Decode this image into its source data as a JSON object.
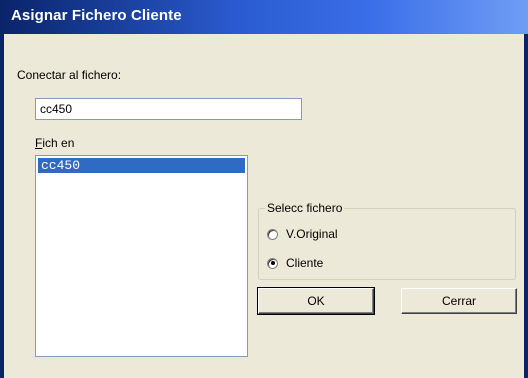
{
  "window": {
    "title": "Asignar Fichero Cliente"
  },
  "connect": {
    "label": "Conectar al fichero:",
    "value": "cc450"
  },
  "list": {
    "label_prefix": "F",
    "label_rest": "ich en",
    "items": [
      "cc450"
    ]
  },
  "select_group": {
    "legend": "Selecc fichero",
    "options": [
      {
        "label": "V.Original",
        "checked": false
      },
      {
        "label": "Cliente",
        "checked": true
      }
    ]
  },
  "buttons": {
    "ok": "OK",
    "close": "Cerrar"
  }
}
